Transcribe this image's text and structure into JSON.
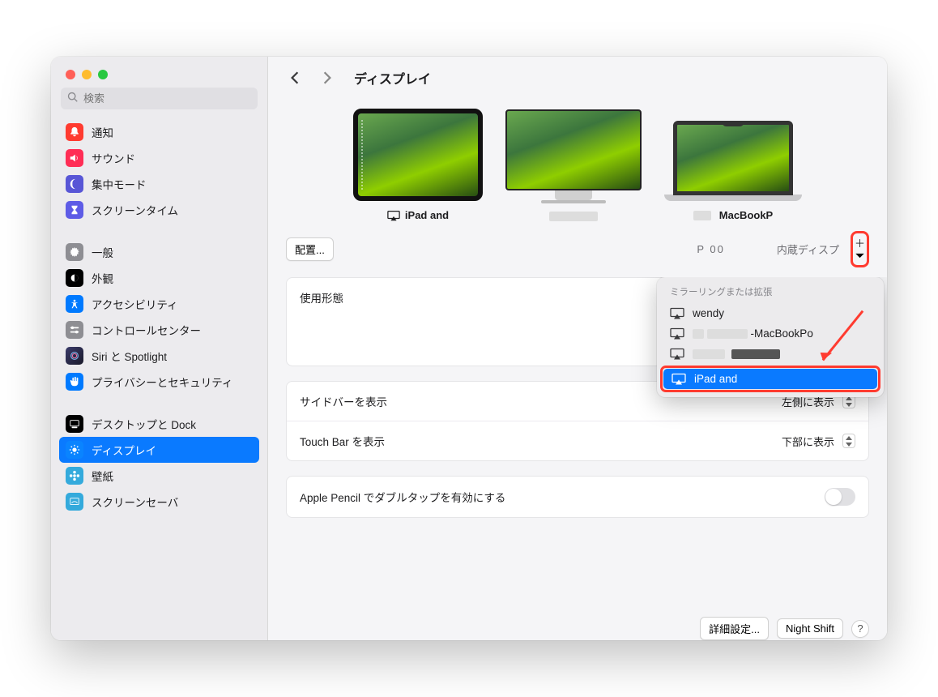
{
  "search": {
    "placeholder": "検索"
  },
  "sidebar": {
    "groups": [
      [
        {
          "id": "notifications",
          "label": "通知"
        },
        {
          "id": "sound",
          "label": "サウンド"
        },
        {
          "id": "focus",
          "label": "集中モード"
        },
        {
          "id": "screentime",
          "label": "スクリーンタイム"
        }
      ],
      [
        {
          "id": "general",
          "label": "一般"
        },
        {
          "id": "appearance",
          "label": "外観"
        },
        {
          "id": "accessibility",
          "label": "アクセシビリティ"
        },
        {
          "id": "controlcenter",
          "label": "コントロールセンター"
        },
        {
          "id": "siri",
          "label": "Siri と Spotlight"
        },
        {
          "id": "privacy",
          "label": "プライバシーとセキュリティ"
        }
      ],
      [
        {
          "id": "desktop",
          "label": "デスクトップと Dock"
        },
        {
          "id": "displays",
          "label": "ディスプレイ",
          "selected": true
        },
        {
          "id": "wallpaper",
          "label": "壁紙"
        },
        {
          "id": "screensaver",
          "label": "スクリーンセーバ"
        }
      ]
    ]
  },
  "header": {
    "title": "ディスプレイ"
  },
  "displays": {
    "d1": {
      "name": "iPad and"
    },
    "d2": {
      "name_visible_fragment": "P        00"
    },
    "d3": {
      "name": "MacBookP",
      "sub": "内蔵ディスプ"
    }
  },
  "arrange_button": "配置...",
  "settings": {
    "use_as_label": "使用形態",
    "sidebar_label": "サイドバーを表示",
    "sidebar_value": "左側に表示",
    "touchbar_label": "Touch Bar を表示",
    "touchbar_value": "下部に表示",
    "pencil_label": "Apple Pencil でダブルタップを有効にする"
  },
  "footer": {
    "advanced": "詳細設定...",
    "nightshift": "Night Shift"
  },
  "popover": {
    "title": "ミラーリングまたは拡張",
    "items": [
      {
        "label": "wendy"
      },
      {
        "label": "-MacBookP",
        "prefix_redacted": true,
        "suffix": "o"
      },
      {
        "label": "",
        "redacted": true
      },
      {
        "label": "iPad and",
        "selected": true
      }
    ]
  }
}
